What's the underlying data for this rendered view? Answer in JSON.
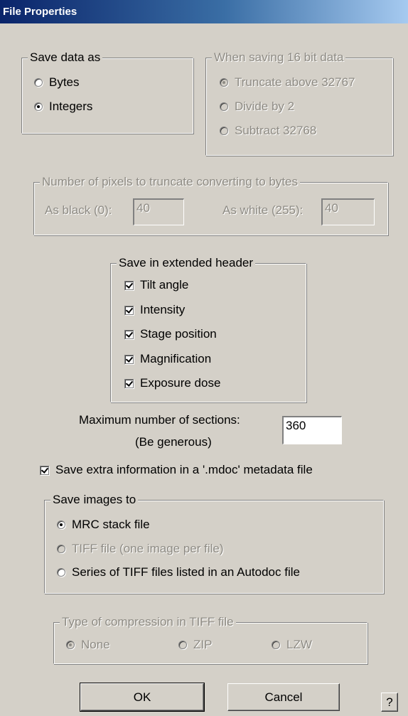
{
  "window": {
    "title": "File Properties"
  },
  "save_data_as": {
    "legend": "Save data as",
    "options": [
      {
        "label": "Bytes",
        "checked": false
      },
      {
        "label": "Integers",
        "checked": true
      }
    ]
  },
  "saving_16bit": {
    "legend": "When saving 16 bit data",
    "enabled": false,
    "options": [
      {
        "label": "Truncate above 32767",
        "checked": true
      },
      {
        "label": "Divide by 2",
        "checked": false
      },
      {
        "label": "Subtract 32768",
        "checked": false
      }
    ]
  },
  "truncate_pixels": {
    "legend": "Number of pixels to truncate converting to bytes",
    "enabled": false,
    "black_label": "As black (0):",
    "black_value": "40",
    "white_label": "As white (255):",
    "white_value": "40"
  },
  "extended_header": {
    "legend": "Save in extended header",
    "items": [
      {
        "label": "Tilt angle",
        "checked": true
      },
      {
        "label": "Intensity",
        "checked": true
      },
      {
        "label": "Stage position",
        "checked": true
      },
      {
        "label": "Magnification",
        "checked": true
      },
      {
        "label": "Exposure dose",
        "checked": true
      }
    ]
  },
  "max_sections": {
    "label_line1": "Maximum number of sections:",
    "label_line2": "(Be generous)",
    "value": "360"
  },
  "mdoc": {
    "label": "Save extra information in a '.mdoc' metadata file",
    "checked": true
  },
  "save_images_to": {
    "legend": "Save images to",
    "options": [
      {
        "label": "MRC stack file",
        "checked": true,
        "enabled": true
      },
      {
        "label": "TIFF file (one image per file)",
        "checked": false,
        "enabled": false
      },
      {
        "label": "Series of TIFF files listed in an Autodoc file",
        "checked": false,
        "enabled": true
      }
    ]
  },
  "compression": {
    "legend": "Type of compression in TIFF file",
    "enabled": false,
    "options": [
      {
        "label": "None",
        "checked": true
      },
      {
        "label": "ZIP",
        "checked": false
      },
      {
        "label": "LZW",
        "checked": false
      }
    ]
  },
  "buttons": {
    "ok": "OK",
    "cancel": "Cancel",
    "help": "?"
  }
}
